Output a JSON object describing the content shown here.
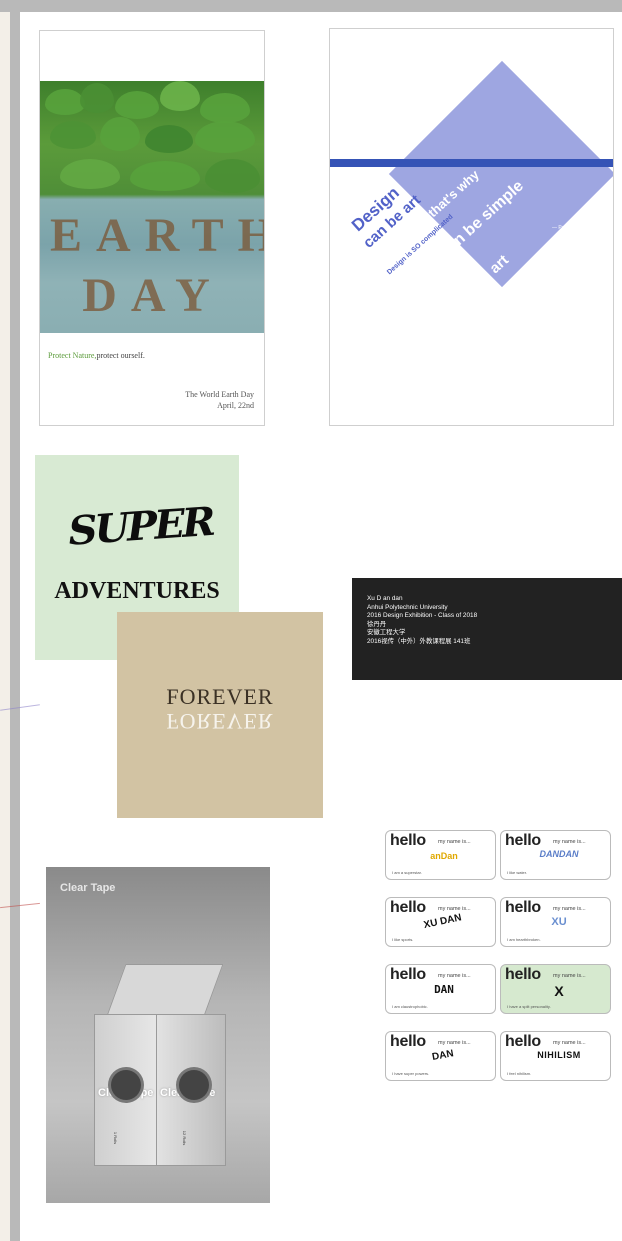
{
  "earth_poster": {
    "word1": "EARTH",
    "word2": "DAY",
    "slogan_green": "Protect Nature,",
    "slogan_dark": "protect ourself.",
    "event": "The World Earth Day",
    "date": "April, 22nd"
  },
  "design_poster": {
    "line1": "Design",
    "line2": "can be art",
    "line3": "that's why",
    "line4": "Design is SO complicated",
    "line5": "Design can be simple",
    "line6": "can be art",
    "attribution": "— Paul · Rand"
  },
  "super_poster": {
    "logo": "SUPER",
    "subtitle": "ADVENTURES"
  },
  "forever_poster": {
    "word": "FOREVER",
    "reflection": "FOREVER"
  },
  "info_card": {
    "lines": [
      "Xu D an dan",
      "Anhui Polytechnic University",
      "2016 Design Exhibition - Class of  2018",
      "徐丹丹",
      "安徽工程大学",
      "2016视传（中外）外教课程展 141班"
    ]
  },
  "clear_tape": {
    "title": "Clear Tape",
    "label_left": "Clear Tape",
    "label_right": "Clear Tape",
    "note1": "1 Rolls",
    "note2": "12 Rolls"
  },
  "hello_cards": [
    {
      "hello": "hello",
      "my_name": "my name is...",
      "art": "anDan",
      "caption": "I am a superstar."
    },
    {
      "hello": "hello",
      "my_name": "my name is...",
      "art": "DANDAN",
      "caption": "I like water."
    },
    {
      "hello": "hello",
      "my_name": "my name is...",
      "art": "XU DAN",
      "caption": "I like sports."
    },
    {
      "hello": "hello",
      "my_name": "my name is...",
      "art": "XU",
      "caption": "I am hearthbroken."
    },
    {
      "hello": "hello",
      "my_name": "my name is...",
      "art": "DAN",
      "caption": "I am claustrophobic."
    },
    {
      "hello": "hello",
      "my_name": "my name is...",
      "art": "X",
      "caption": "I have a split personality."
    },
    {
      "hello": "hello",
      "my_name": "my name is...",
      "art": "DAN",
      "caption": "I have super  powers."
    },
    {
      "hello": "hello",
      "my_name": "my name is...",
      "art": "NIHILISM",
      "caption": "I feel nihilism."
    }
  ],
  "colors": {
    "frame": "#b9b9b9",
    "design_blue": "#3553b6",
    "design_lilac": "#8d96dc",
    "super_bg": "#d8ead3",
    "forever_bg": "#d2c3a3",
    "info_bg": "#222222"
  }
}
